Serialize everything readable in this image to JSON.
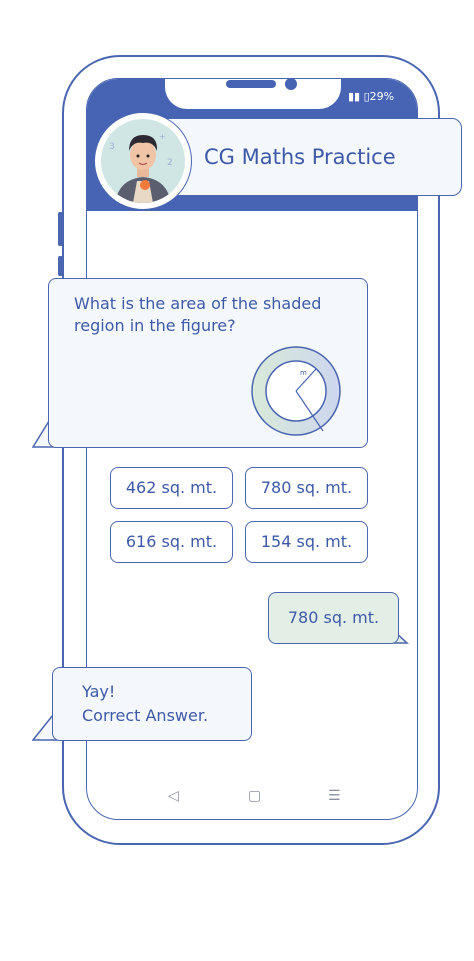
{
  "status_bar": {
    "battery": "29%"
  },
  "header": {
    "title": "CG Maths Practice"
  },
  "question": {
    "text": "What is the area of the shaded region in the figure?",
    "figure_label": "m"
  },
  "options": [
    "462 sq. mt.",
    "780 sq. mt.",
    "616 sq. mt.",
    "154 sq. mt."
  ],
  "user_answer": "780 sq. mt.",
  "feedback": {
    "line1": "Yay!",
    "line2": "Correct Answer."
  },
  "nav": {
    "back": "◁",
    "home": "▢",
    "menu": "☰"
  },
  "colors": {
    "primary": "#4764b4",
    "bubble": "#f4f7fb",
    "answer_bubble": "#e3eee7",
    "stroke": "#4a66b0"
  }
}
